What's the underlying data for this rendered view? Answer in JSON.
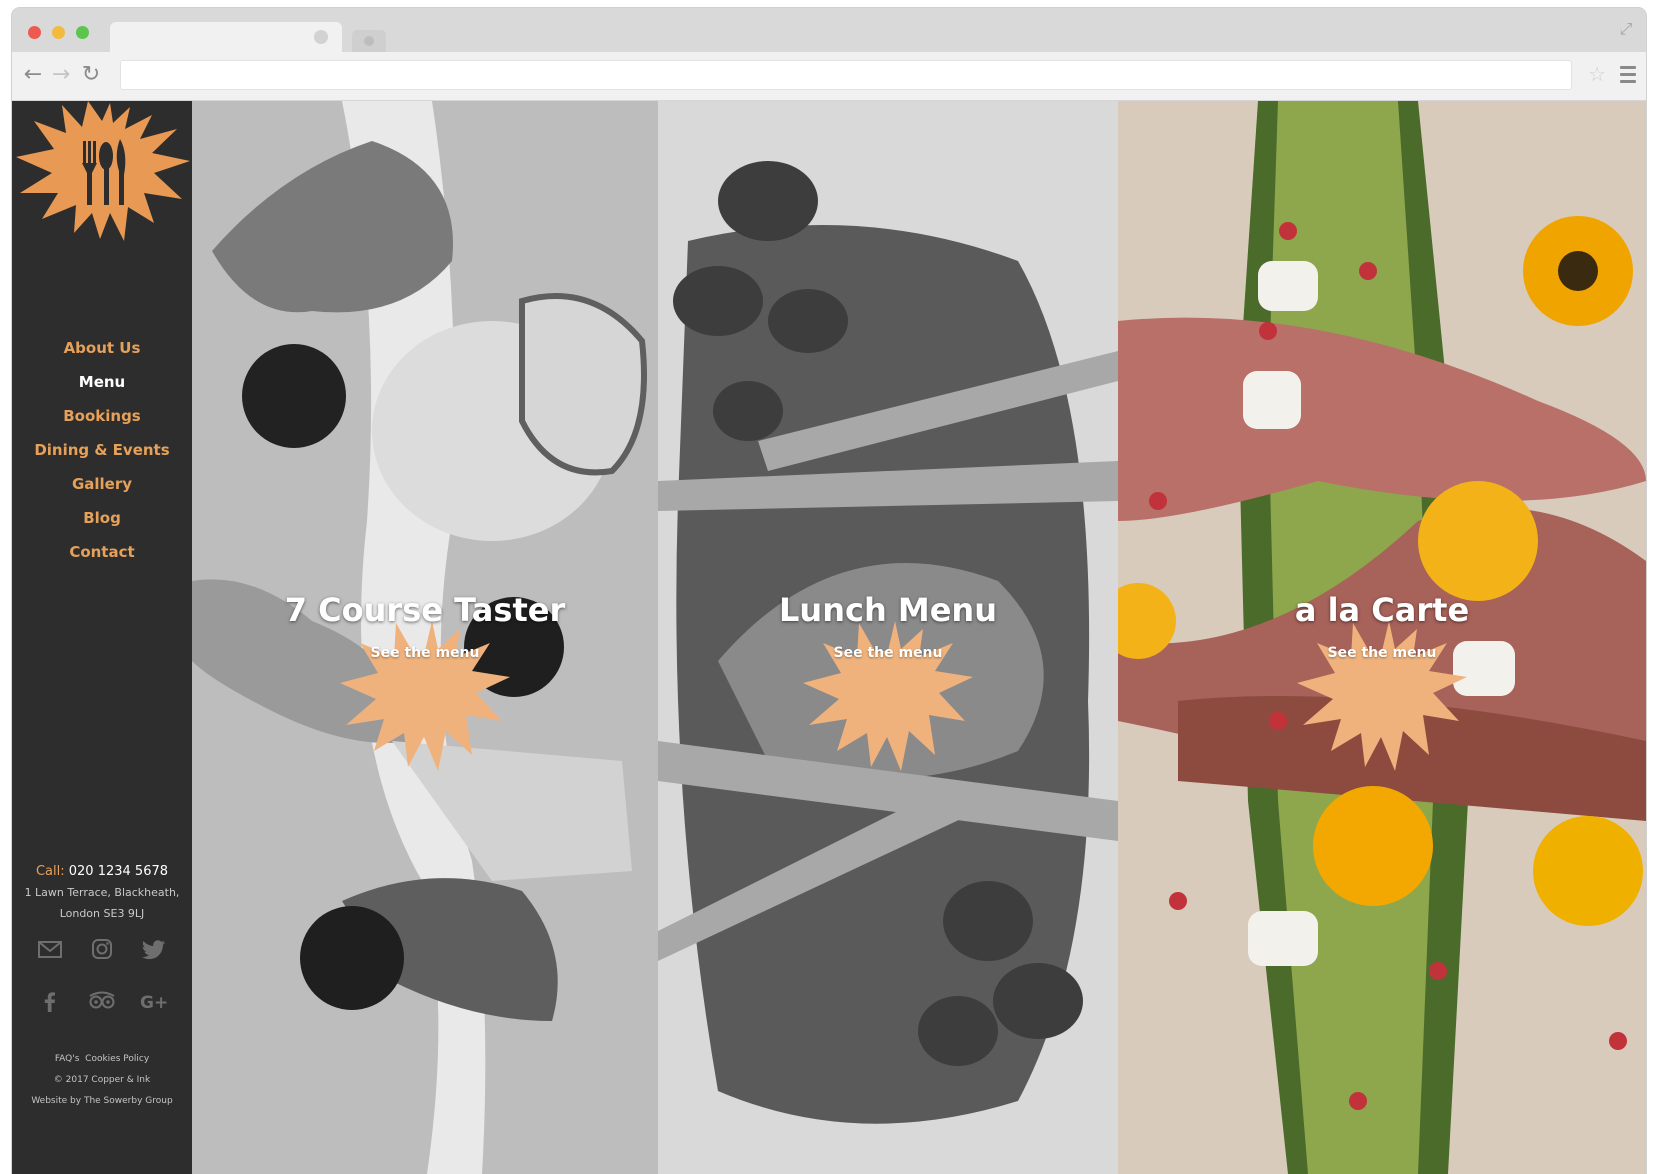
{
  "browser": {
    "url": ""
  },
  "sidebar": {
    "nav": [
      {
        "label": "About Us",
        "active": false
      },
      {
        "label": "Menu",
        "active": true
      },
      {
        "label": "Bookings",
        "active": false
      },
      {
        "label": "Dining & Events",
        "active": false
      },
      {
        "label": "Gallery",
        "active": false
      },
      {
        "label": "Blog",
        "active": false
      },
      {
        "label": "Contact",
        "active": false
      }
    ],
    "contact": {
      "call_label": "Call:",
      "phone": "020 1234 5678",
      "address_line1": "1 Lawn Terrace, Blackheath,",
      "address_line2": "London SE3 9LJ"
    },
    "social_icons": [
      "email-icon",
      "instagram-icon",
      "twitter-icon",
      "facebook-icon",
      "tripadvisor-icon",
      "google-plus-icon"
    ],
    "footer": {
      "faqs": "FAQ's",
      "cookies": "Cookies Policy",
      "copyright": "© 2017 Copper & Ink",
      "credit": "Website by The Sowerby Group"
    }
  },
  "panels": [
    {
      "title": "7 Course Taster",
      "link": "See the menu"
    },
    {
      "title": "Lunch Menu",
      "link": "See the menu"
    },
    {
      "title": "a la Carte",
      "link": "See the menu"
    }
  ],
  "colors": {
    "accent": "#e5a059",
    "sidebar_bg": "#2d2d2d",
    "splash": "#f0b27c"
  }
}
